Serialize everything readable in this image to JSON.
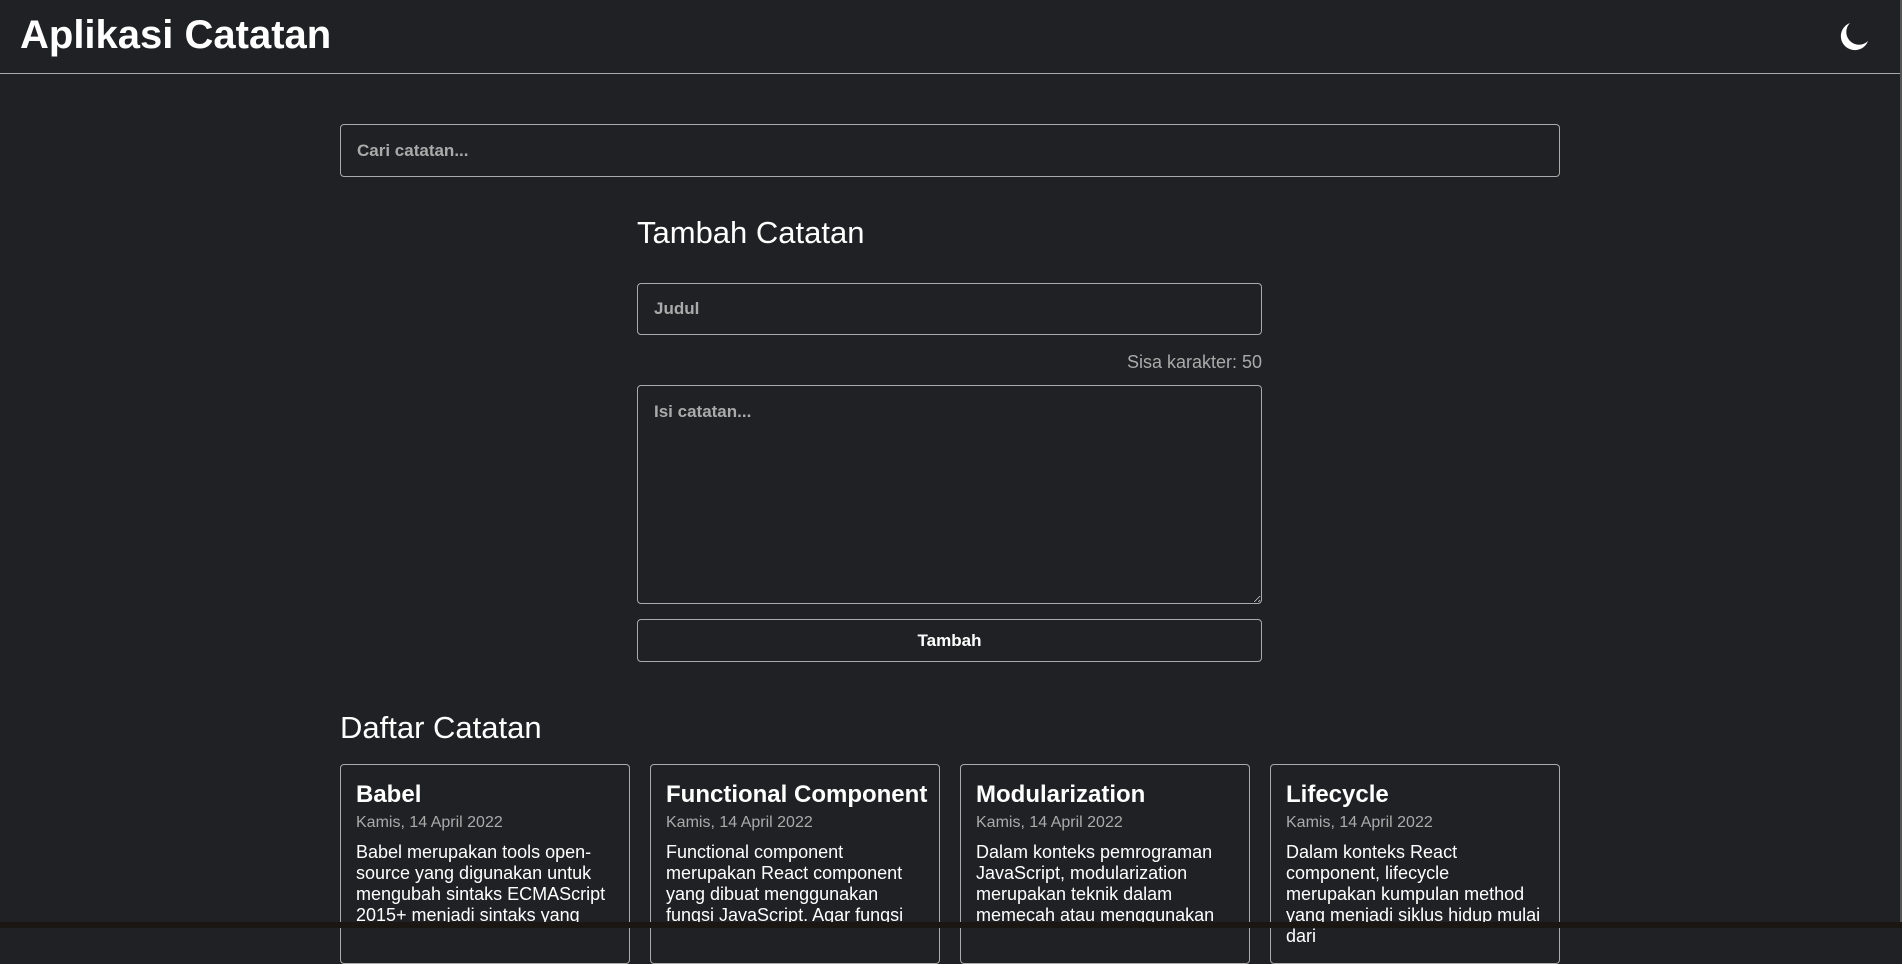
{
  "header": {
    "title": "Aplikasi Catatan",
    "theme_icon": "moon-icon"
  },
  "search": {
    "placeholder": "Cari catatan...",
    "value": ""
  },
  "note_input": {
    "title": "Tambah Catatan",
    "title_placeholder": "Judul",
    "char_counter": "Sisa karakter: 50",
    "body_placeholder": "Isi catatan...",
    "submit_label": "Tambah"
  },
  "notes": {
    "title": "Daftar Catatan",
    "items": [
      {
        "title": "Babel",
        "date": "Kamis, 14 April 2022",
        "body": "Babel merupakan tools open-source yang digunakan untuk mengubah sintaks ECMAScript 2015+ menjadi sintaks yang"
      },
      {
        "title": "Functional Component",
        "date": "Kamis, 14 April 2022",
        "body": "Functional component merupakan React component yang dibuat menggunakan fungsi JavaScript. Agar fungsi"
      },
      {
        "title": "Modularization",
        "date": "Kamis, 14 April 2022",
        "body": "Dalam konteks pemrograman JavaScript, modularization merupakan teknik dalam memecah atau menggunakan"
      },
      {
        "title": "Lifecycle",
        "date": "Kamis, 14 April 2022",
        "body": "Dalam konteks React component, lifecycle merupakan kumpulan method yang menjadi siklus hidup mulai dari"
      }
    ]
  },
  "colors": {
    "background": "#202124",
    "text": "#ffffff",
    "muted": "#aaaaaa",
    "border": "#aaaaaa"
  }
}
